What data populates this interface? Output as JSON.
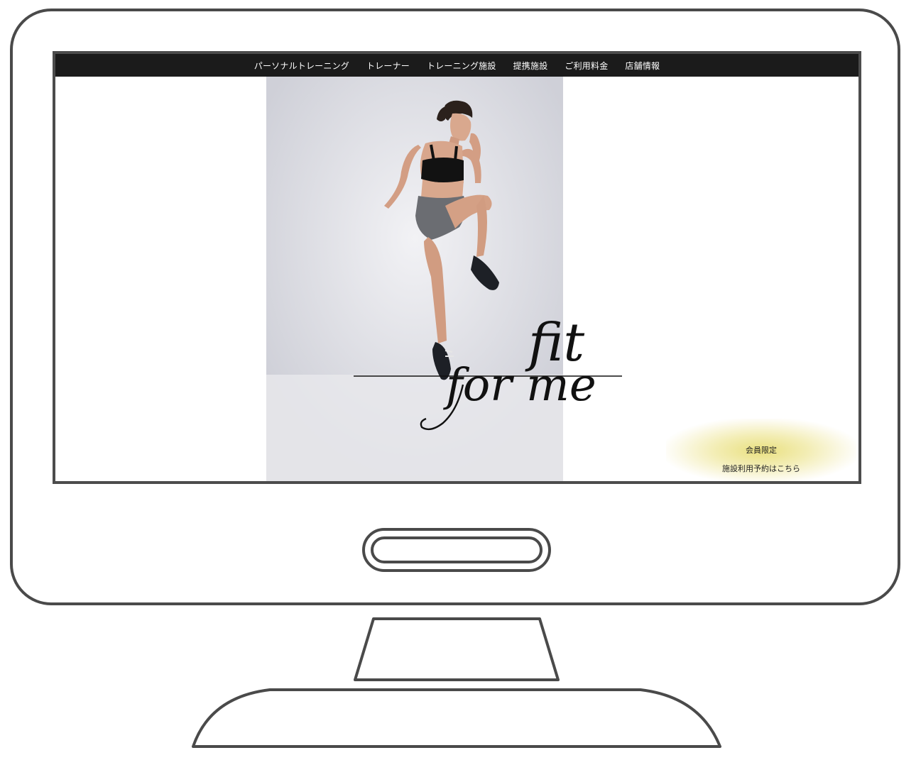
{
  "nav": {
    "items": [
      {
        "label": "パーソナルトレーニング"
      },
      {
        "label": "トレーナー"
      },
      {
        "label": "トレーニング施設"
      },
      {
        "label": "提携施設"
      },
      {
        "label": "ご利用料金"
      },
      {
        "label": "店舗情報"
      }
    ]
  },
  "hero": {
    "image_alt": "jumping-athlete-photo"
  },
  "logo": {
    "line1": "fit",
    "line2": "for me"
  },
  "cta": {
    "line1": "会員限定",
    "line2": "施設利用予約はこちら",
    "glow_color": "#e8de78"
  },
  "colors": {
    "navbar": "#1b1b1b",
    "frame": "#4a4a4a"
  }
}
